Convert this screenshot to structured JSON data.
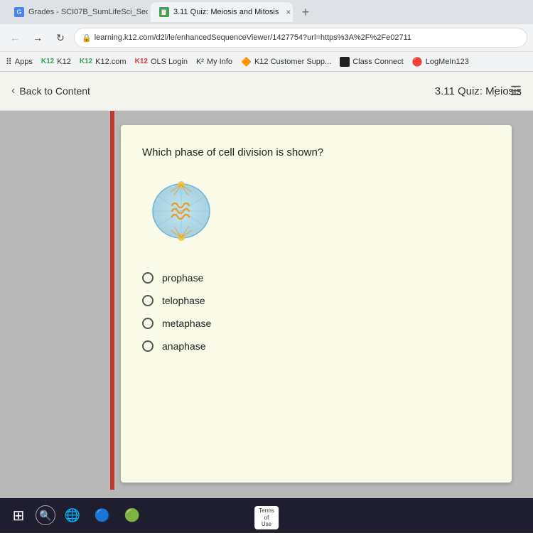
{
  "browser": {
    "tabs": [
      {
        "id": "tab1",
        "label": "Grades - SCI07B_SumLifeSci_Sec...",
        "active": false,
        "favicon_color": "#4a86e8"
      },
      {
        "id": "tab2",
        "label": "3.11 Quiz: Meiosis and Mitosis",
        "active": true,
        "favicon_color": "#34a853"
      },
      {
        "id": "new_tab",
        "label": "+"
      }
    ],
    "address": "learning.k12.com/d2l/le/enhancedSequenceViewer/1427754?url=https%3A%2F%2Fe02711",
    "bookmarks": [
      {
        "label": "Apps",
        "icon": "grid"
      },
      {
        "label": "K12",
        "icon": "k12-green"
      },
      {
        "label": "K12.com",
        "icon": "k12-text"
      },
      {
        "label": "OLS Login",
        "icon": "k12-red"
      },
      {
        "label": "My Info",
        "icon": "k12-blue"
      },
      {
        "label": "K12 Customer Supp...",
        "icon": "arrow"
      },
      {
        "label": "Class Connect",
        "icon": "square-black"
      },
      {
        "label": "LogMeIn123",
        "icon": "circle-orange"
      }
    ]
  },
  "toolbar": {
    "back_label": "Back to Content",
    "quiz_title": "3.11 Quiz: Meiosis"
  },
  "quiz": {
    "question": "Which phase of cell division is shown?",
    "options": [
      {
        "id": "opt1",
        "label": "prophase"
      },
      {
        "id": "opt2",
        "label": "telophase"
      },
      {
        "id": "opt3",
        "label": "metaphase"
      },
      {
        "id": "opt4",
        "label": "anaphase"
      }
    ]
  },
  "taskbar": {
    "windows_icon": "⊞",
    "search_icon": "🔍",
    "terms_label": "Terms\nof\nUse"
  }
}
